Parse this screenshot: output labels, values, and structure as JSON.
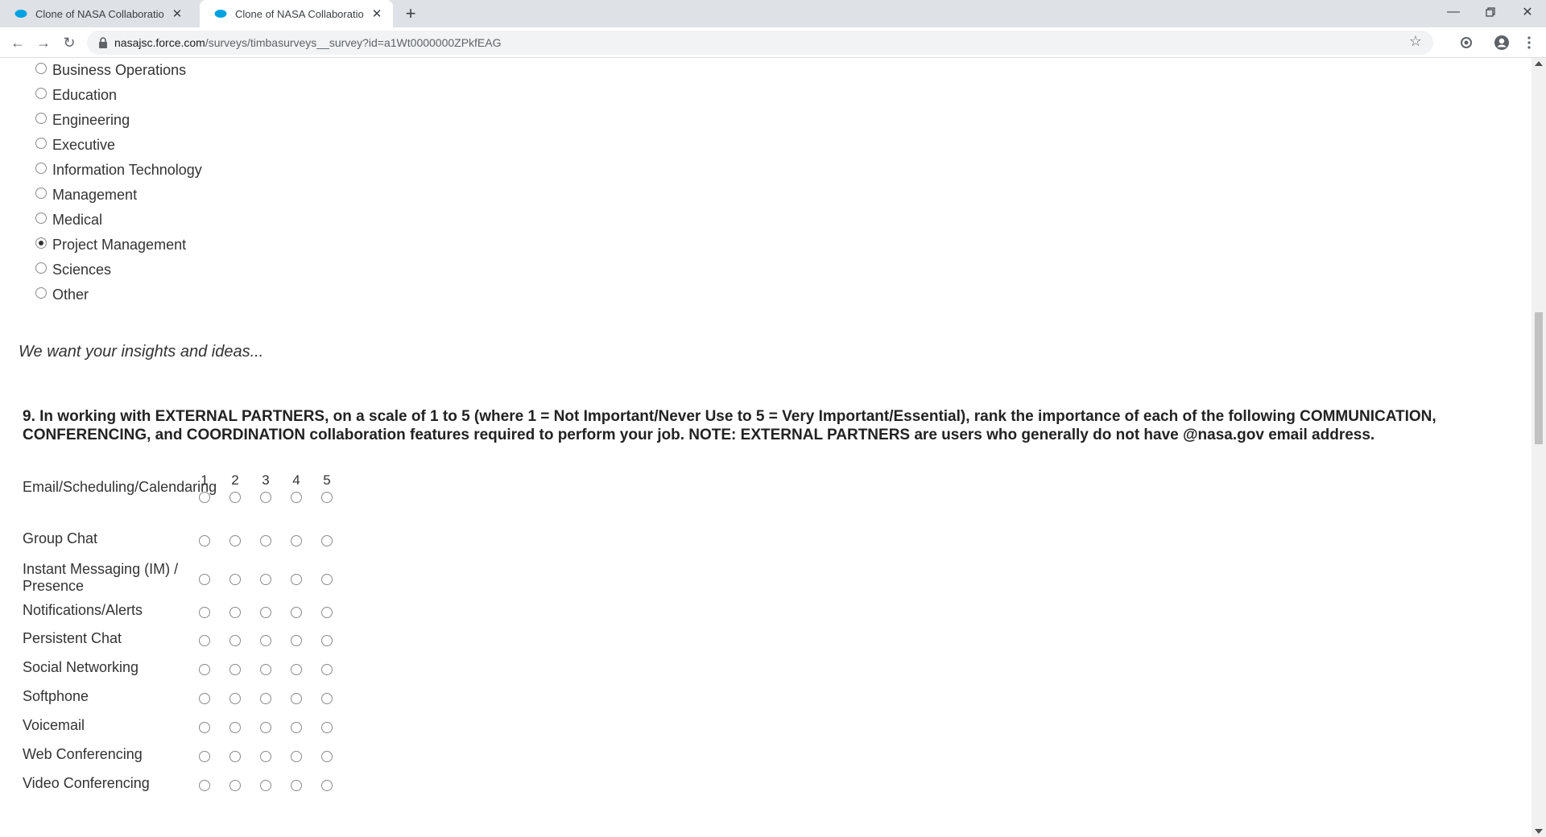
{
  "browser": {
    "tabs": [
      {
        "title": "Clone of NASA Collaboration Fee",
        "active": false
      },
      {
        "title": "Clone of NASA Collaboration Fee",
        "active": true
      }
    ],
    "url_host": "nasajsc.force.com",
    "url_path": "/surveys/timbasurveys__survey?id=a1Wt0000000ZPkfEAG",
    "accent": "#1a73e8"
  },
  "survey": {
    "job_options": [
      {
        "label": "Business Operations",
        "checked": false
      },
      {
        "label": "Education",
        "checked": false
      },
      {
        "label": "Engineering",
        "checked": false
      },
      {
        "label": "Executive",
        "checked": false
      },
      {
        "label": "Information Technology",
        "checked": false
      },
      {
        "label": "Management",
        "checked": false
      },
      {
        "label": "Medical",
        "checked": false
      },
      {
        "label": "Project Management",
        "checked": true
      },
      {
        "label": "Sciences",
        "checked": false
      },
      {
        "label": "Other",
        "checked": false
      }
    ],
    "section_intro": "We want your insights and ideas...",
    "question9": {
      "text": "9. In working with EXTERNAL PARTNERS, on a scale of 1 to 5 (where 1 = Not Important/Never Use to 5 = Very Important/Essential), rank the importance of each of the following COMMUNICATION, CONFERENCING, and COORDINATION collaboration features required to perform your job. NOTE: EXTERNAL PARTNERS are users who generally do not have @nasa.gov email address.",
      "scale": [
        "1",
        "2",
        "3",
        "4",
        "5"
      ],
      "rows": [
        "Email/Scheduling/Calendaring",
        "Group Chat",
        "Instant Messaging (IM) / Presence",
        "Notifications/Alerts",
        "Persistent Chat",
        "Social Networking",
        "Softphone",
        "Voicemail",
        "Web Conferencing",
        "Video Conferencing"
      ]
    }
  }
}
